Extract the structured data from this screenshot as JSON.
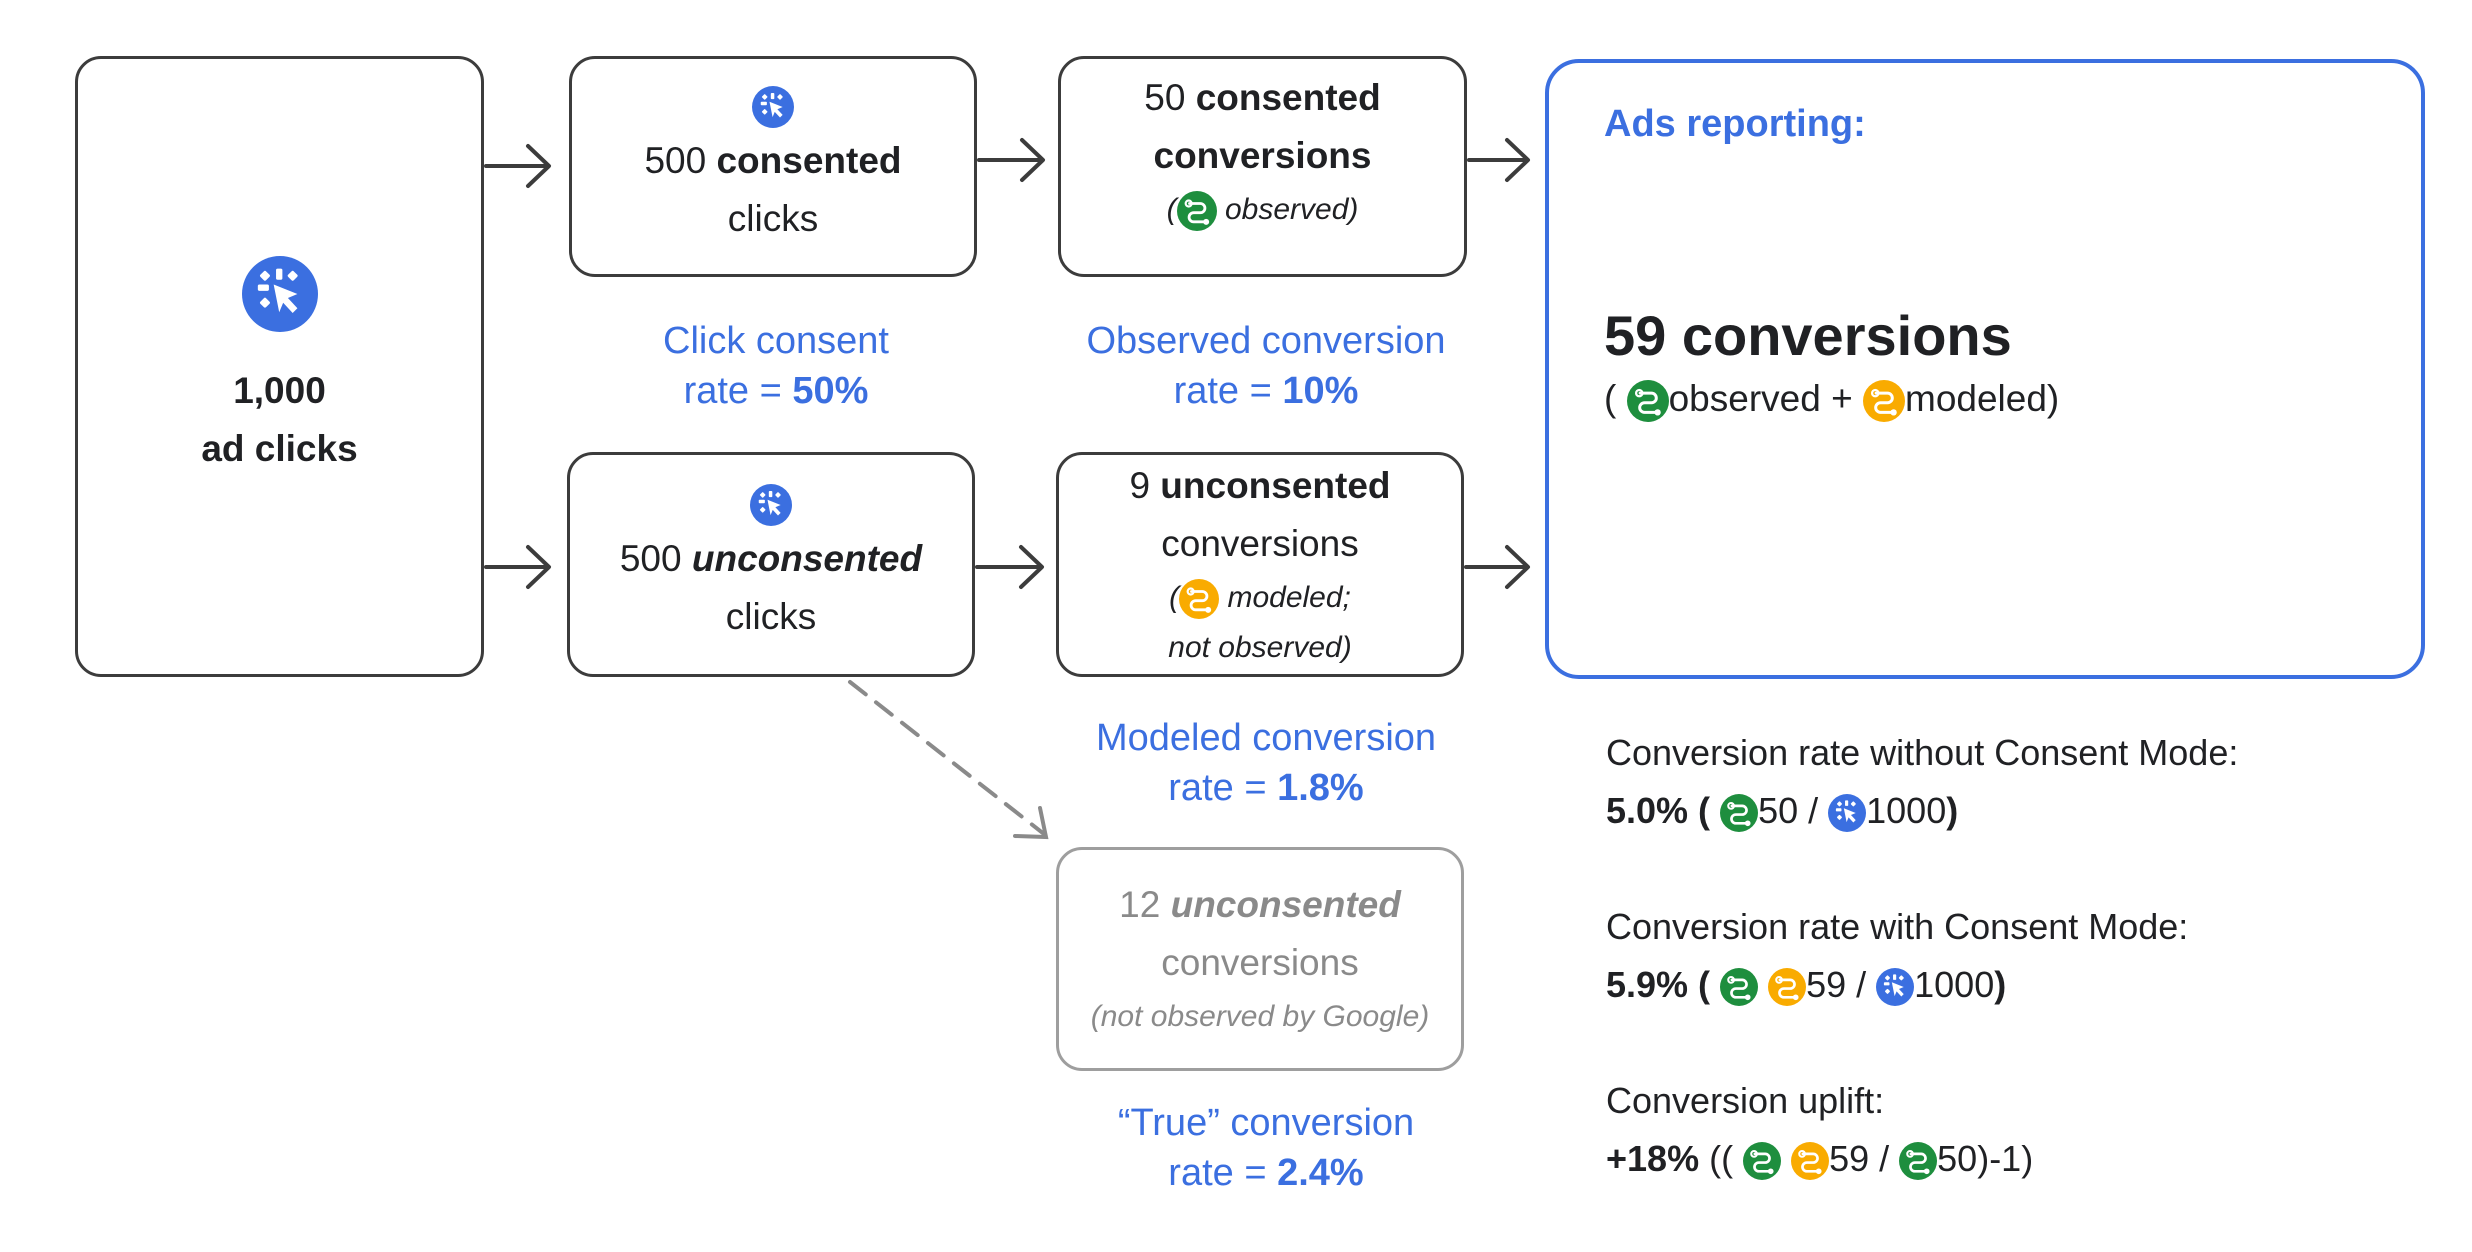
{
  "colors": {
    "blue": "#3b6fe0",
    "green": "#1e8e3e",
    "orange": "#f9ab00",
    "grey": "#8a8a8a",
    "text": "#202124"
  },
  "icons": {
    "click": "cursor-click-icon",
    "observed": "conversion-path-icon-green",
    "modeled": "conversion-path-icon-orange"
  },
  "ad_clicks": {
    "count": "1,000",
    "label": "ad clicks"
  },
  "consented_clicks": {
    "count": "500",
    "bold": "consented",
    "label": "clicks"
  },
  "unconsented_clicks": {
    "count": "500",
    "bold_italic": "unconsented",
    "label": "clicks"
  },
  "consented_conversions": {
    "count": "50",
    "bold1": "consented",
    "bold2": "conversions",
    "note_open": "(",
    "note": "observed)"
  },
  "unconsented_conversions": {
    "count": "9",
    "bold": "unconsented",
    "label": "conversions",
    "note_open": "(",
    "note1": "modeled;",
    "note2": "not observed)"
  },
  "true_unconsented": {
    "count": "12",
    "bold_italic": "unconsented",
    "label": "conversions",
    "note": "(not observed by Google)"
  },
  "rates": {
    "click_consent": {
      "line1": "Click consent",
      "prefix": "rate = ",
      "value": "50%"
    },
    "observed": {
      "line1": "Observed conversion",
      "prefix": "rate = ",
      "value": "10%"
    },
    "modeled": {
      "line1": "Modeled conversion",
      "prefix": "rate = ",
      "value": "1.8%"
    },
    "true": {
      "line1": "“True” conversion",
      "prefix": "rate = ",
      "value": "2.4%"
    }
  },
  "ads_reporting": {
    "title": "Ads reporting:",
    "total": "59 conversions",
    "open": "(",
    "observed": "observed + ",
    "modeled": "modeled)"
  },
  "formulas": {
    "without": {
      "label": "Conversion rate without Consent Mode:",
      "value": "5.0% (",
      "n1": "50 / ",
      "n2": "1000",
      "close": ")"
    },
    "with": {
      "label": "Conversion rate with Consent Mode:",
      "value": "5.9% (",
      "n1": "59 / ",
      "n2": "1000",
      "close": ")"
    },
    "uplift": {
      "label": "Conversion uplift:",
      "value": "+18%",
      "open": " ((",
      "n1": "59 / ",
      "n2": "50)-1)"
    }
  }
}
